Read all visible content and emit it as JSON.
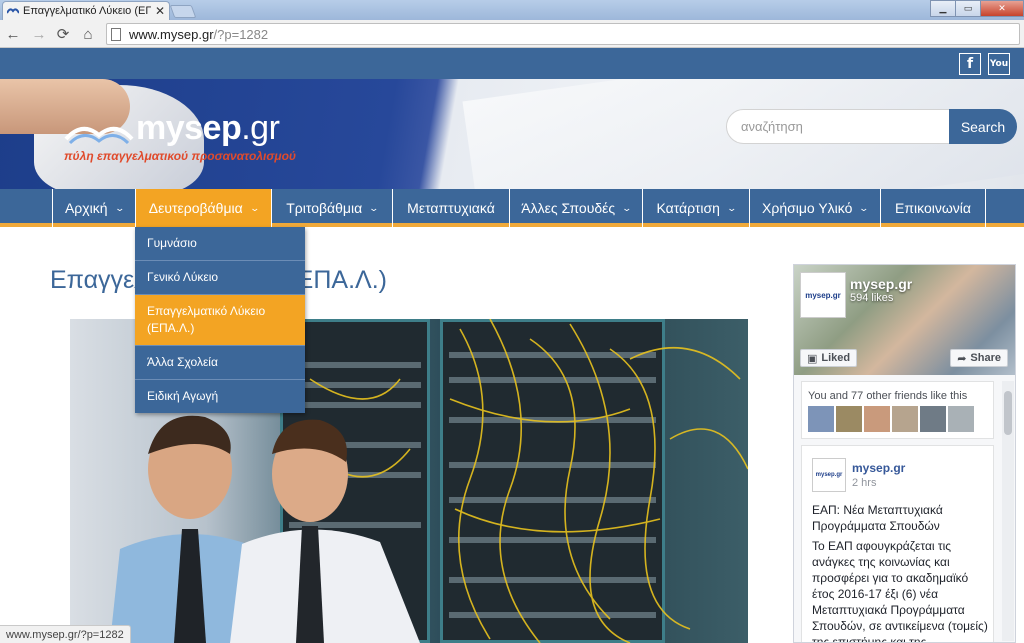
{
  "browser": {
    "tab_title": "Επαγγελματικό Λύκειο (ΕΠ",
    "tab_close": "✕",
    "url_host": "www.mysep.gr",
    "url_path": "/?p=1282",
    "status_url": "www.mysep.gr/?p=1282"
  },
  "header": {
    "logo_text": "mysep",
    "logo_suffix": ".gr",
    "logo_tagline": "πύλη επαγγελματικού προσανατολισμού",
    "search_placeholder": "αναζήτηση",
    "search_button": "Search",
    "social": {
      "facebook": "f",
      "youtube": "You"
    }
  },
  "nav": {
    "items": [
      {
        "label": "Αρχική",
        "has_dropdown": true
      },
      {
        "label": "Δευτεροβάθμια",
        "has_dropdown": true,
        "active": true
      },
      {
        "label": "Τριτοβάθμια",
        "has_dropdown": true
      },
      {
        "label": "Μεταπτυχιακά",
        "has_dropdown": false
      },
      {
        "label": "Άλλες Σπουδές",
        "has_dropdown": true
      },
      {
        "label": "Κατάρτιση",
        "has_dropdown": true
      },
      {
        "label": "Χρήσιμο Υλικό",
        "has_dropdown": true
      },
      {
        "label": "Επικοινωνία",
        "has_dropdown": false
      }
    ],
    "dropdown": [
      {
        "label": "Γυμνάσιο"
      },
      {
        "label": "Γενικό Λύκειο"
      },
      {
        "label": "Επαγγελματικό Λύκειο (ΕΠΑ.Λ.)",
        "active": true
      },
      {
        "label": "Άλλα Σχολεία"
      },
      {
        "label": "Ειδική Αγωγή"
      }
    ],
    "chevron": "⌄"
  },
  "content": {
    "title_left": "Επαγγελ",
    "title_right": "ΕΠΑ.Λ.)"
  },
  "facebook_widget": {
    "page_name": "mysep.gr",
    "likes": "594 likes",
    "liked_label": "Liked",
    "share_label": "Share",
    "friends_text": "You and 77 other friends like this",
    "post": {
      "author": "mysep.gr",
      "time": "2 hrs",
      "title": "ΕΑΠ: Νέα Μεταπτυχιακά Προγράμματα Σπουδών",
      "body": "Το ΕΑΠ αφουγκράζεται τις ανάγκες της κοινωνίας και προσφέρει για το ακαδημαϊκό έτος 2016-17 έξι (6) νέα Μεταπτυχιακά Προγράμματα Σπουδών, σε αντικείμενα (τομείς) της επιστήμης και της"
    },
    "avatar_text": "mysep.gr"
  },
  "colors": {
    "brand_blue": "#3c6799",
    "accent_orange": "#f3a423"
  }
}
